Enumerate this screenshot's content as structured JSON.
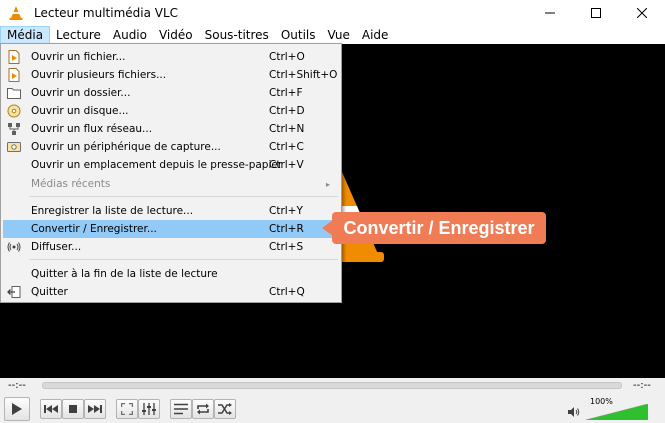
{
  "window": {
    "title": "Lecteur multimédia VLC",
    "icons": [
      "vlc-cone-icon",
      "minimize-icon",
      "maximize-icon",
      "close-icon"
    ]
  },
  "menubar": {
    "items": [
      {
        "label": "Média",
        "active": true
      },
      {
        "label": "Lecture"
      },
      {
        "label": "Audio"
      },
      {
        "label": "Vidéo"
      },
      {
        "label": "Sous-titres"
      },
      {
        "label": "Outils"
      },
      {
        "label": "Vue"
      },
      {
        "label": "Aide"
      }
    ]
  },
  "media_menu": {
    "items": [
      {
        "label": "Ouvrir un fichier...",
        "shortcut": "Ctrl+O",
        "icon": "file-icon"
      },
      {
        "label": "Ouvrir plusieurs fichiers...",
        "shortcut": "Ctrl+Shift+O",
        "icon": "files-icon"
      },
      {
        "label": "Ouvrir un dossier...",
        "shortcut": "Ctrl+F",
        "icon": "folder-icon"
      },
      {
        "label": "Ouvrir un disque...",
        "shortcut": "Ctrl+D",
        "icon": "disc-icon"
      },
      {
        "label": "Ouvrir un flux réseau...",
        "shortcut": "Ctrl+N",
        "icon": "network-icon"
      },
      {
        "label": "Ouvrir un périphérique de capture...",
        "shortcut": "Ctrl+C",
        "icon": "capture-device-icon"
      },
      {
        "label": "Ouvrir un emplacement depuis le presse-papier",
        "shortcut": "Ctrl+V",
        "icon": ""
      },
      {
        "label": "Médias récents",
        "shortcut": "",
        "icon": "",
        "disabled": true,
        "submenu_arrow": "▸"
      },
      {
        "label": "Enregistrer la liste de lecture...",
        "shortcut": "Ctrl+Y",
        "icon": ""
      },
      {
        "label": "Convertir / Enregistrer...",
        "shortcut": "Ctrl+R",
        "icon": "",
        "highlighted": true
      },
      {
        "label": "Diffuser...",
        "shortcut": "Ctrl+S",
        "icon": "stream-icon"
      },
      {
        "label": "Quitter à la fin de la liste de lecture",
        "shortcut": "",
        "icon": ""
      },
      {
        "label": "Quitter",
        "shortcut": "Ctrl+Q",
        "icon": "quit-icon"
      }
    ]
  },
  "callout": {
    "text": "Convertir / Enregistrer",
    "color": "#f07c56"
  },
  "seekbar": {
    "elapsed": "--:--",
    "remaining": "--:--"
  },
  "controls": {
    "buttons": [
      "play-icon",
      "previous-icon",
      "stop-icon",
      "next-icon",
      "fullscreen-icon",
      "extended-settings-icon",
      "playlist-icon",
      "loop-icon",
      "shuffle-icon"
    ],
    "volume": {
      "label": "100%",
      "level": 1.0,
      "color": "#2ec02e"
    }
  },
  "colors": {
    "highlight": "#91c9f7",
    "menu_active": "#cce8ff",
    "vlc_orange": "#f08c00"
  }
}
